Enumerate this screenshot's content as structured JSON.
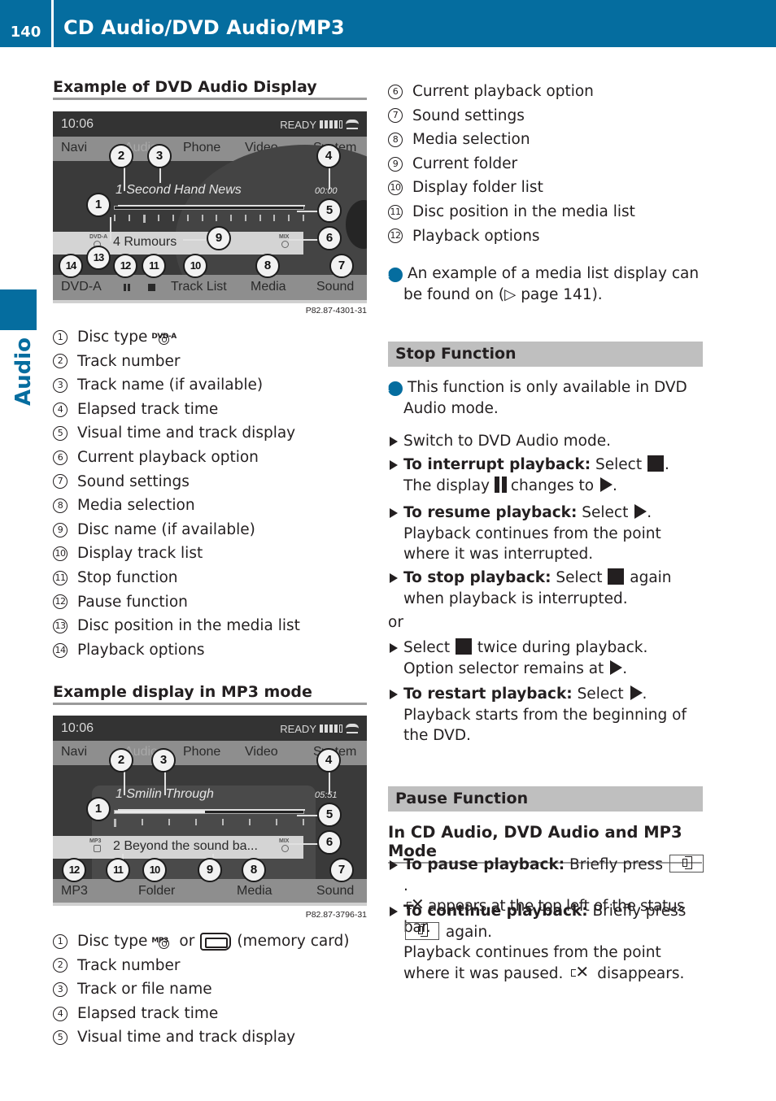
{
  "header": {
    "page_number": "140",
    "title": "CD Audio/DVD Audio/MP3"
  },
  "side_tab": {
    "label": "Audio"
  },
  "colors": {
    "brand_blue": "#056d9f",
    "section_bar_gray": "#bfbfbf",
    "rule_gray": "#9a9a9a"
  },
  "dvd_section": {
    "heading": "Example of DVD Audio Display",
    "screen": {
      "time": "10:06",
      "status": "READY",
      "signal_bars": 4,
      "signal_total": 5,
      "menu": [
        "Navi",
        "Audio",
        "Phone",
        "Video",
        "System"
      ],
      "track": "1 Second Hand News",
      "elapsed": "00:00",
      "progress_fraction": 0.0,
      "disc_type_icon": "DVD-A",
      "disc_name": "4 Rumours",
      "mix_icon": "MIX",
      "bottom_menu": [
        "DVD-A",
        "pause",
        "stop",
        "Track List",
        "Media",
        "Sound"
      ],
      "callouts": [
        "1",
        "2",
        "3",
        "4",
        "5",
        "6",
        "7",
        "8",
        "9",
        "10",
        "11",
        "12",
        "13",
        "14"
      ]
    },
    "caption": "P82.87-4301-31",
    "legend": [
      {
        "n": "1",
        "text": "Disc type",
        "icon": "dvd-a-disc-icon",
        "icon_label": "DVD-A"
      },
      {
        "n": "2",
        "text": "Track number"
      },
      {
        "n": "3",
        "text": "Track name (if available)"
      },
      {
        "n": "4",
        "text": "Elapsed track time"
      },
      {
        "n": "5",
        "text": "Visual time and track display"
      },
      {
        "n": "6",
        "text": "Current playback option"
      },
      {
        "n": "7",
        "text": "Sound settings"
      },
      {
        "n": "8",
        "text": "Media selection"
      },
      {
        "n": "9",
        "text": "Disc name (if available)"
      },
      {
        "n": "10",
        "text": "Display track list"
      },
      {
        "n": "11",
        "text": "Stop function"
      },
      {
        "n": "12",
        "text": "Pause function"
      },
      {
        "n": "13",
        "text": "Disc position in the media list"
      },
      {
        "n": "14",
        "text": "Playback options"
      }
    ]
  },
  "mp3_section": {
    "heading": "Example display in MP3 mode",
    "screen": {
      "time": "10:06",
      "status": "READY",
      "signal_bars": 4,
      "signal_total": 5,
      "menu": [
        "Navi",
        "Audio",
        "Phone",
        "Video",
        "System"
      ],
      "track": "1 Smilin Through",
      "elapsed": "05:51",
      "progress_fraction": 0.48,
      "disc_type_icon": "MP3",
      "disc_name": "2 Beyond the sound ba...",
      "mix_icon": "MIX",
      "bottom_menu": [
        "MP3",
        "Folder",
        "Media",
        "Sound"
      ],
      "callouts": [
        "1",
        "2",
        "3",
        "4",
        "5",
        "6",
        "7",
        "8",
        "9",
        "10",
        "11",
        "12"
      ]
    },
    "caption": "P82.87-3796-31",
    "legend": [
      {
        "n": "1",
        "text": "Disc type",
        "icon": "mp3-disc-icon",
        "icon_label": "MP3",
        "or": "or",
        "suffix": "(memory card)"
      },
      {
        "n": "2",
        "text": "Track number"
      },
      {
        "n": "3",
        "text": "Track or file name"
      },
      {
        "n": "4",
        "text": "Elapsed track time"
      },
      {
        "n": "5",
        "text": "Visual time and track display"
      },
      {
        "n": "6",
        "text": "Current playback option"
      },
      {
        "n": "7",
        "text": "Sound settings"
      },
      {
        "n": "8",
        "text": "Media selection"
      },
      {
        "n": "9",
        "text": "Current folder"
      },
      {
        "n": "10",
        "text": "Display folder list"
      },
      {
        "n": "11",
        "text": "Disc position in the media list"
      },
      {
        "n": "12",
        "text": "Playback options"
      }
    ],
    "info_note": {
      "before": "An example of a media list display can be found on (",
      "arrow": "▷",
      "link": "page 141",
      "after": ")."
    }
  },
  "stop_function": {
    "heading": "Stop Function",
    "info": "This function is only available in DVD Audio mode.",
    "steps": [
      {
        "text": "Switch to DVD Audio mode."
      },
      {
        "bold": "To interrupt playback:",
        "text": " Select",
        "after_icon": ".",
        "line2_a": "The display",
        "line2_b": "changes to",
        "line2_c": "."
      },
      {
        "bold": "To resume playback:",
        "text": " Select",
        "after_icon": ".",
        "line2": "Playback continues from the point where it was interrupted."
      },
      {
        "bold": "To stop playback:",
        "text": " Select",
        "after_icon": " again when playback is interrupted."
      }
    ],
    "or_label": "or",
    "steps_after_or": [
      {
        "text": "Select",
        "after_icon": " twice during playback.",
        "line2_a": "Option selector remains at",
        "line2_c": "."
      },
      {
        "bold": "To restart playback:",
        "text": " Select",
        "after_icon": ".",
        "line2": "Playback starts from the beginning of the DVD."
      }
    ]
  },
  "pause_function": {
    "heading": "Pause Function",
    "subheading": "In CD Audio, DVD Audio and MP3 Mode",
    "steps": [
      {
        "bold": "To pause playback:",
        "text": " Briefly press",
        "after_icon": ".",
        "line2": "appears at the top left of the status bar."
      },
      {
        "bold": "To continue playback:",
        "text": " Briefly press",
        "line2": "again.",
        "line3_a": "Playback continues from the point where it was paused.",
        "line3_b": "disappears."
      }
    ]
  }
}
